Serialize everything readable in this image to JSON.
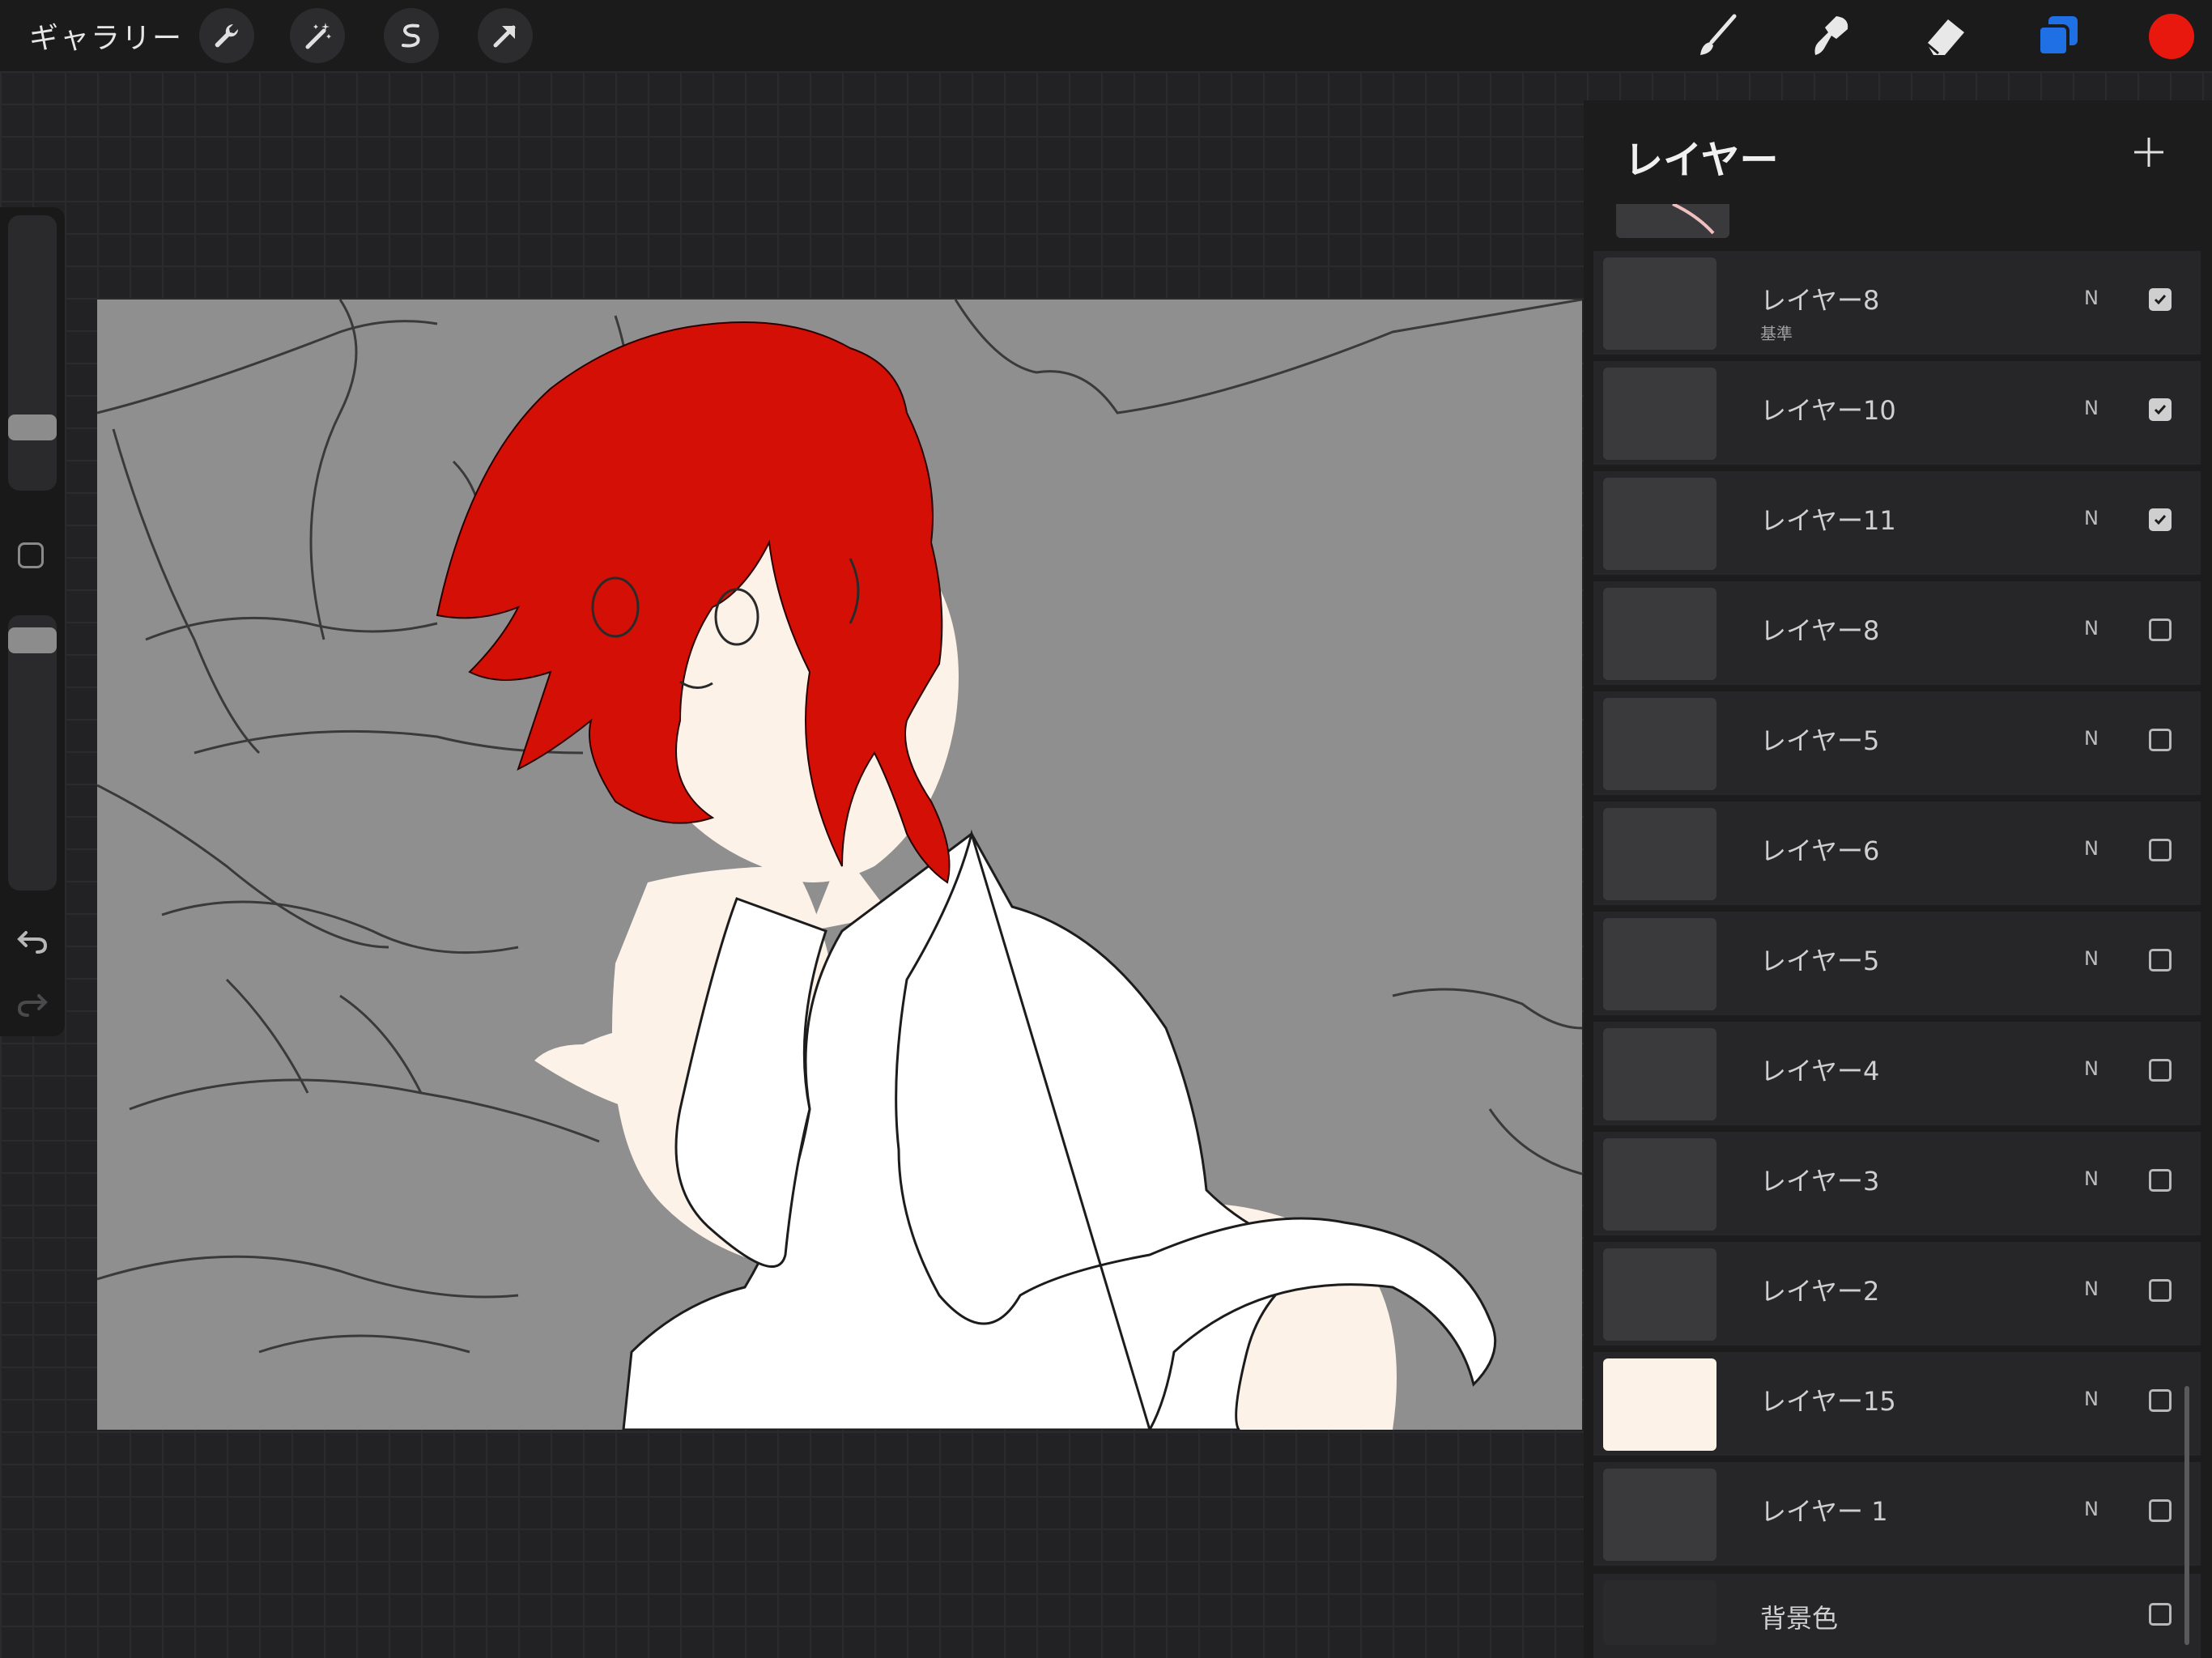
{
  "toolbar": {
    "gallery_label": "ギャラリー",
    "left_tools": [
      "wrench-icon",
      "magic-wand-icon",
      "selection-icon",
      "transform-arrow-icon"
    ],
    "right_tools": [
      "brush-icon",
      "smudge-icon",
      "eraser-icon",
      "layers-icon"
    ],
    "active_color": "#e8180f",
    "layers_accent": "#1f6fe5"
  },
  "sidebar": {
    "brush_size_level": 0.2,
    "opacity_level": 0.95
  },
  "canvas": {
    "background_color": "#8f8f8f",
    "hair_color": "#d40f05",
    "skin_color": "#fdf2e8"
  },
  "layers_panel": {
    "title": "レイヤー",
    "layers": [
      {
        "name": "レイヤー8",
        "sub": "基準",
        "blend": "N",
        "visible": true
      },
      {
        "name": "レイヤー10",
        "sub": "",
        "blend": "N",
        "visible": true
      },
      {
        "name": "レイヤー11",
        "sub": "",
        "blend": "N",
        "visible": true
      },
      {
        "name": "レイヤー8",
        "sub": "",
        "blend": "N",
        "visible": false
      },
      {
        "name": "レイヤー5",
        "sub": "",
        "blend": "N",
        "visible": false
      },
      {
        "name": "レイヤー6",
        "sub": "",
        "blend": "N",
        "visible": false
      },
      {
        "name": "レイヤー5",
        "sub": "",
        "blend": "N",
        "visible": false
      },
      {
        "name": "レイヤー4",
        "sub": "",
        "blend": "N",
        "visible": false
      },
      {
        "name": "レイヤー3",
        "sub": "",
        "blend": "N",
        "visible": false
      },
      {
        "name": "レイヤー2",
        "sub": "",
        "blend": "N",
        "visible": false
      },
      {
        "name": "レイヤー15",
        "sub": "",
        "blend": "N",
        "visible": false
      },
      {
        "name": "レイヤー 1",
        "sub": "",
        "blend": "N",
        "visible": false
      }
    ],
    "background_layer": {
      "name": "背景色",
      "visible": false
    }
  }
}
